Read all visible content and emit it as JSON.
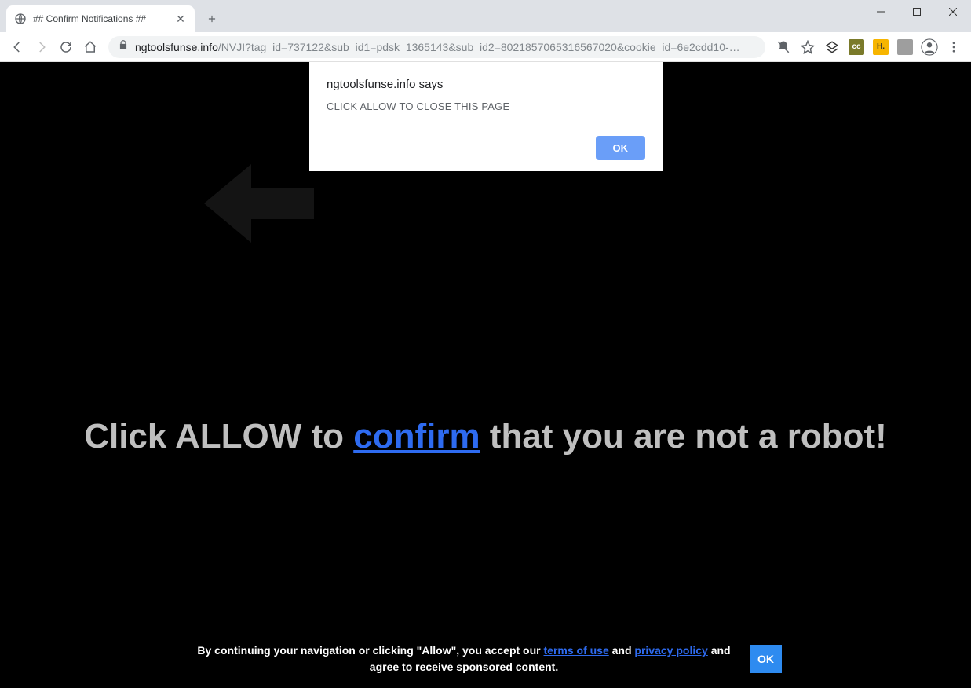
{
  "window": {
    "tab_title": "## Confirm Notifications ##"
  },
  "toolbar": {
    "url_domain": "ngtoolsfunse.info",
    "url_path": "/NVJI?tag_id=737122&sub_id1=pdsk_1365143&sub_id2=8021857065316567020&cookie_id=6e2cdd10-…",
    "ext_labels": {
      "cc": "cc",
      "h": "H."
    }
  },
  "alert": {
    "title": "ngtoolsfunse.info says",
    "message": "CLICK ALLOW TO CLOSE THIS PAGE",
    "ok": "OK"
  },
  "page": {
    "headline_pre": "Click ALLOW to ",
    "headline_link": "confirm",
    "headline_post": " that you are not a robot!",
    "footer_pre": "By continuing your navigation or clicking \"Allow\", you accept our ",
    "footer_terms": "terms of use",
    "footer_and": " and ",
    "footer_privacy": "privacy policy",
    "footer_post": " and agree to receive sponsored content.",
    "footer_ok": "OK"
  }
}
